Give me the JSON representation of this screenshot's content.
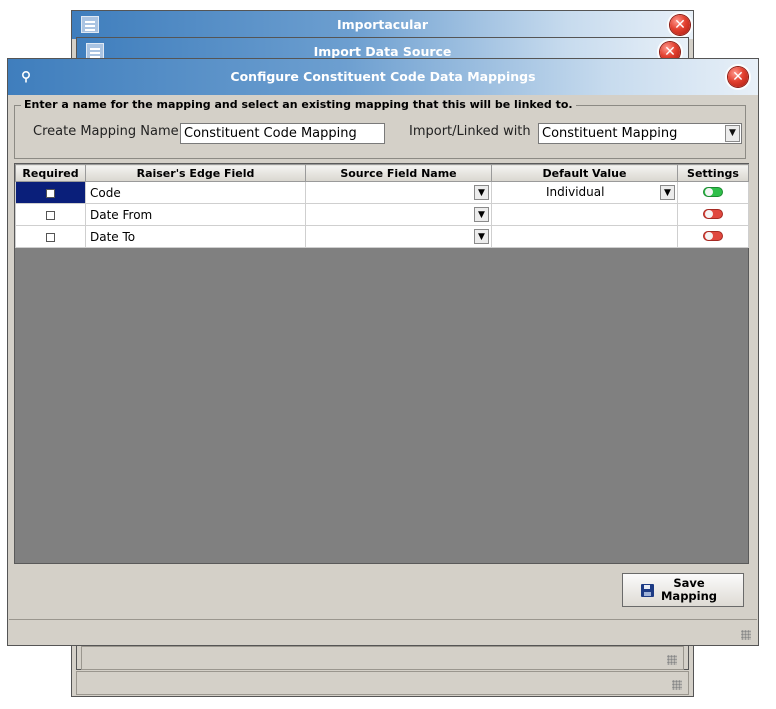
{
  "windows": {
    "back1": {
      "title": "Importacular",
      "close_glyph": "✕"
    },
    "back2": {
      "title": "Import Data Source",
      "close_glyph": "✕"
    },
    "main": {
      "title": "Configure Constituent Code Data Mappings",
      "close_glyph": "✕"
    }
  },
  "mapping_group": {
    "legend": "Enter a name for the mapping and select an existing mapping that this will be linked to.",
    "name_label": "Create Mapping Name",
    "name_value": "Constituent Code Mapping",
    "linked_label": "Import/Linked with",
    "linked_value": "Constituent Mapping"
  },
  "grid": {
    "columns": [
      "Required",
      "Raiser's Edge Field",
      "Source Field Name",
      "Default Value",
      "Settings"
    ],
    "rows": [
      {
        "field": "Code",
        "source": "",
        "default": "Individual",
        "settings": "on"
      },
      {
        "field": "Date From",
        "source": "",
        "default": "",
        "settings": "off"
      },
      {
        "field": "Date To",
        "source": "",
        "default": "",
        "settings": "off"
      }
    ]
  },
  "save_button": {
    "line1": "Save",
    "line2": "Mapping"
  },
  "icons": {
    "dropdown_arrow": "▼",
    "window_icon": "list-window-icon",
    "title_pin": "map-pin-icon",
    "save": "floppy-disk-icon"
  },
  "colors": {
    "titlebar_start": "#3f7ebd",
    "selection": "#0a1f7a",
    "toggle_on": "#2fbf4a",
    "toggle_off": "#e0483f",
    "grid_background": "#808080"
  }
}
